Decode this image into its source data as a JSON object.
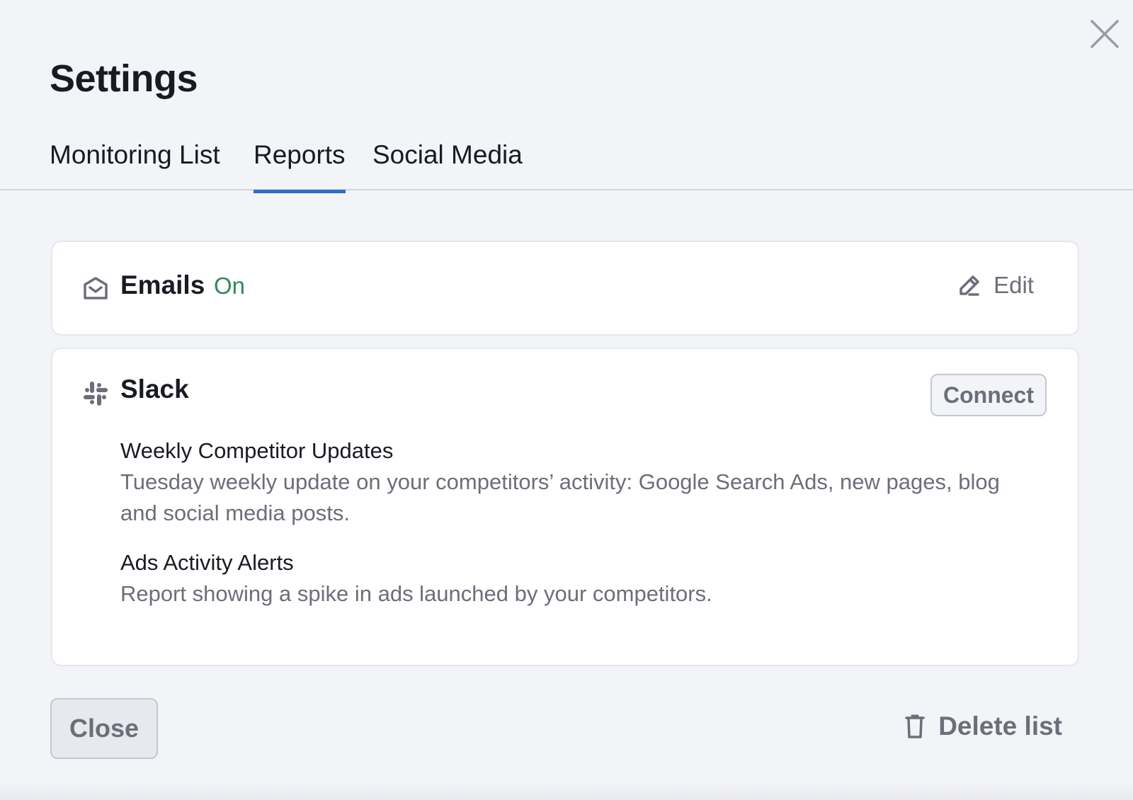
{
  "dialog": {
    "title": "Settings",
    "close_icon": "close-icon"
  },
  "tabs": [
    {
      "label": "Monitoring List",
      "active": false
    },
    {
      "label": "Reports",
      "active": true
    },
    {
      "label": "Social Media",
      "active": false
    }
  ],
  "emails": {
    "icon": "envelope-open-icon",
    "title": "Emails",
    "status": "On",
    "edit_label": "Edit",
    "edit_icon": "pencil-icon"
  },
  "slack": {
    "icon": "slack-icon",
    "title": "Slack",
    "connect_label": "Connect",
    "reports": [
      {
        "name": "Weekly Competitor Updates",
        "description": "Tuesday weekly update on your competitors’ activity: Google Search Ads, new pages, blog and social media posts."
      },
      {
        "name": "Ads Activity Alerts",
        "description": "Report showing a spike in ads launched by your competitors."
      }
    ]
  },
  "footer": {
    "close_label": "Close",
    "delete_label": "Delete list",
    "delete_icon": "trash-icon"
  },
  "colors": {
    "accent": "#2c6ecb",
    "status_on": "#2f8a5c",
    "background": "#f3f4f8"
  }
}
